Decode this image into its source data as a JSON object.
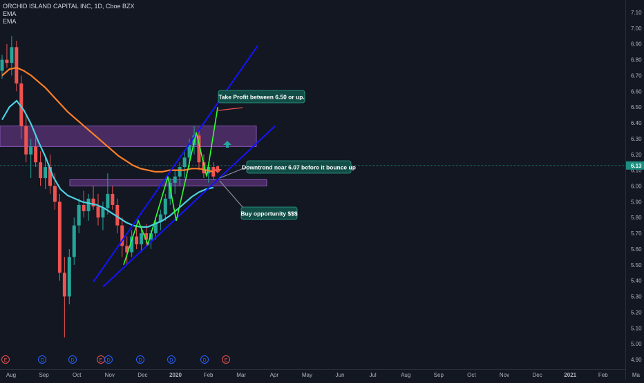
{
  "header": {
    "symbol_line": "ORCHID ISLAND CAPITAL INC, 1D, Cboe BZX",
    "indicator_1": "EMA",
    "indicator_2": "EMA"
  },
  "colors": {
    "background": "#131722",
    "candle_up": "#26a69a",
    "candle_down": "#ef5350",
    "ema_fast": "#4dd0e1",
    "ema_slow": "#ff7f27",
    "channel": "#1414ff",
    "zigzag": "#32ff32",
    "zone": "#7b3fa0",
    "callout": "#124e47",
    "callout_border": "#2ea58f",
    "price_label": "#1b8e80"
  },
  "chart_data": {
    "type": "candlestick",
    "title": "ORCHID ISLAND CAPITAL INC, 1D, Cboe BZX",
    "x_ticks": [
      "Aug",
      "Sep",
      "Oct",
      "Nov",
      "Dec",
      "2020",
      "Feb",
      "Mar",
      "Apr",
      "May",
      "Jun",
      "Jul",
      "Aug",
      "Sep",
      "Oct",
      "Nov",
      "Dec",
      "2021",
      "Feb",
      "Ma"
    ],
    "y_ticks": [
      "7.10",
      "7.00",
      "6.90",
      "6.80",
      "6.70",
      "6.60",
      "6.50",
      "6.40",
      "6.30",
      "6.20",
      "6.10",
      "6.00",
      "5.90",
      "5.80",
      "5.70",
      "5.60",
      "5.50",
      "5.40",
      "5.30",
      "5.20",
      "5.10",
      "5.00",
      "4.90"
    ],
    "ylim": [
      4.88,
      7.14
    ],
    "last_price": "6.13",
    "grid": false,
    "series": [
      {
        "name": "EMA",
        "color": "#4dd0e1",
        "points": [
          [
            0,
            6.42
          ],
          [
            2,
            6.5
          ],
          [
            4,
            6.54
          ],
          [
            6,
            6.48
          ],
          [
            8,
            6.39
          ],
          [
            10,
            6.28
          ],
          [
            12,
            6.18
          ],
          [
            14,
            6.06
          ],
          [
            16,
            5.98
          ],
          [
            18,
            5.94
          ],
          [
            20,
            5.92
          ],
          [
            22,
            5.9
          ],
          [
            24,
            5.89
          ],
          [
            26,
            5.88
          ],
          [
            28,
            5.86
          ],
          [
            30,
            5.83
          ],
          [
            32,
            5.8
          ],
          [
            34,
            5.77
          ],
          [
            36,
            5.75
          ],
          [
            38,
            5.74
          ],
          [
            40,
            5.74
          ],
          [
            42,
            5.76
          ],
          [
            44,
            5.78
          ],
          [
            46,
            5.81
          ],
          [
            48,
            5.85
          ],
          [
            50,
            5.89
          ],
          [
            52,
            5.93
          ],
          [
            54,
            5.96
          ],
          [
            56,
            5.98
          ],
          [
            58,
            5.99
          ]
        ]
      },
      {
        "name": "EMA",
        "color": "#ff7f27",
        "points": [
          [
            0,
            6.7
          ],
          [
            2,
            6.74
          ],
          [
            4,
            6.75
          ],
          [
            6,
            6.73
          ],
          [
            8,
            6.7
          ],
          [
            10,
            6.66
          ],
          [
            12,
            6.62
          ],
          [
            14,
            6.57
          ],
          [
            16,
            6.52
          ],
          [
            18,
            6.47
          ],
          [
            20,
            6.43
          ],
          [
            22,
            6.39
          ],
          [
            24,
            6.35
          ],
          [
            26,
            6.31
          ],
          [
            28,
            6.27
          ],
          [
            30,
            6.23
          ],
          [
            32,
            6.19
          ],
          [
            34,
            6.16
          ],
          [
            36,
            6.13
          ],
          [
            38,
            6.11
          ],
          [
            40,
            6.1
          ],
          [
            42,
            6.09
          ],
          [
            44,
            6.09
          ],
          [
            46,
            6.1
          ],
          [
            48,
            6.1
          ],
          [
            50,
            6.1
          ],
          [
            52,
            6.11
          ],
          [
            54,
            6.11
          ],
          [
            56,
            6.1
          ],
          [
            58,
            6.09
          ]
        ]
      }
    ],
    "candles": [
      [
        6.73,
        6.83,
        6.68,
        6.8
      ],
      [
        6.8,
        6.9,
        6.75,
        6.78
      ],
      [
        6.78,
        6.95,
        6.7,
        6.88
      ],
      [
        6.88,
        6.92,
        6.6,
        6.65
      ],
      [
        6.65,
        6.7,
        6.3,
        6.38
      ],
      [
        6.38,
        6.45,
        6.15,
        6.2
      ],
      [
        6.2,
        6.3,
        6.05,
        6.25
      ],
      [
        6.25,
        6.32,
        6.12,
        6.15
      ],
      [
        6.15,
        6.22,
        6.0,
        6.05
      ],
      [
        6.05,
        6.18,
        5.98,
        6.12
      ],
      [
        6.12,
        6.2,
        5.95,
        6.0
      ],
      [
        6.0,
        6.08,
        5.85,
        5.9
      ],
      [
        5.9,
        5.95,
        5.4,
        5.45
      ],
      [
        5.45,
        5.55,
        5.04,
        5.3
      ],
      [
        5.3,
        5.6,
        5.25,
        5.55
      ],
      [
        5.55,
        5.8,
        5.5,
        5.75
      ],
      [
        5.75,
        5.92,
        5.7,
        5.88
      ],
      [
        5.88,
        5.97,
        5.8,
        5.84
      ],
      [
        5.84,
        5.95,
        5.78,
        5.92
      ],
      [
        5.92,
        6.0,
        5.85,
        5.87
      ],
      [
        5.87,
        5.95,
        5.75,
        5.8
      ],
      [
        5.8,
        5.9,
        5.72,
        5.86
      ],
      [
        5.86,
        6.08,
        5.82,
        5.95
      ],
      [
        5.95,
        6.0,
        5.85,
        5.88
      ],
      [
        5.88,
        5.92,
        5.7,
        5.75
      ],
      [
        5.75,
        5.8,
        5.55,
        5.62
      ],
      [
        5.62,
        5.68,
        5.5,
        5.58
      ],
      [
        5.58,
        5.72,
        5.55,
        5.68
      ],
      [
        5.68,
        5.75,
        5.6,
        5.63
      ],
      [
        5.63,
        5.73,
        5.58,
        5.7
      ],
      [
        5.7,
        5.76,
        5.62,
        5.66
      ],
      [
        5.66,
        5.72,
        5.6,
        5.7
      ],
      [
        5.7,
        5.8,
        5.66,
        5.77
      ],
      [
        5.77,
        5.85,
        5.72,
        5.82
      ],
      [
        5.82,
        5.95,
        5.78,
        5.92
      ],
      [
        5.92,
        6.05,
        5.88,
        6.02
      ],
      [
        6.02,
        6.1,
        5.95,
        6.06
      ],
      [
        6.06,
        6.15,
        6.0,
        6.12
      ],
      [
        6.12,
        6.22,
        6.05,
        6.18
      ],
      [
        6.18,
        6.3,
        6.12,
        6.26
      ],
      [
        6.26,
        6.38,
        6.2,
        6.32
      ],
      [
        6.32,
        6.36,
        6.1,
        6.15
      ],
      [
        6.15,
        6.2,
        6.05,
        6.08
      ],
      [
        6.08,
        6.15,
        6.02,
        6.12
      ],
      [
        6.12,
        6.15,
        6.04,
        6.06
      ]
    ],
    "zones": [
      {
        "y0": 6.38,
        "y1": 6.25
      },
      {
        "y0": 6.04,
        "y1": 6.0
      }
    ],
    "channel_lines": [
      {
        "x0": 0.1447,
        "y0": 5.39,
        "x1": 0.4003,
        "y1": 6.89
      },
      {
        "x0": 0.1598,
        "y0": 5.36,
        "x1": 0.4271,
        "y1": 6.38
      }
    ],
    "zigzag": [
      [
        0.192,
        5.5
      ],
      [
        0.2146,
        5.78
      ],
      [
        0.2296,
        5.63
      ],
      [
        0.2608,
        6.06
      ],
      [
        0.2737,
        5.78
      ],
      [
        0.3048,
        6.34
      ],
      [
        0.3209,
        6.06
      ],
      [
        0.3381,
        6.5
      ]
    ],
    "annotations": [
      {
        "text": "Take Profit between 6.50 or up."
      },
      {
        "text": "Downtrend near 6.07 before it bounce up"
      },
      {
        "text": "Buy opportunity $$$"
      }
    ],
    "event_markers": [
      "E",
      "D",
      "D",
      "E",
      "D",
      "D",
      "D",
      "D",
      "E"
    ]
  }
}
